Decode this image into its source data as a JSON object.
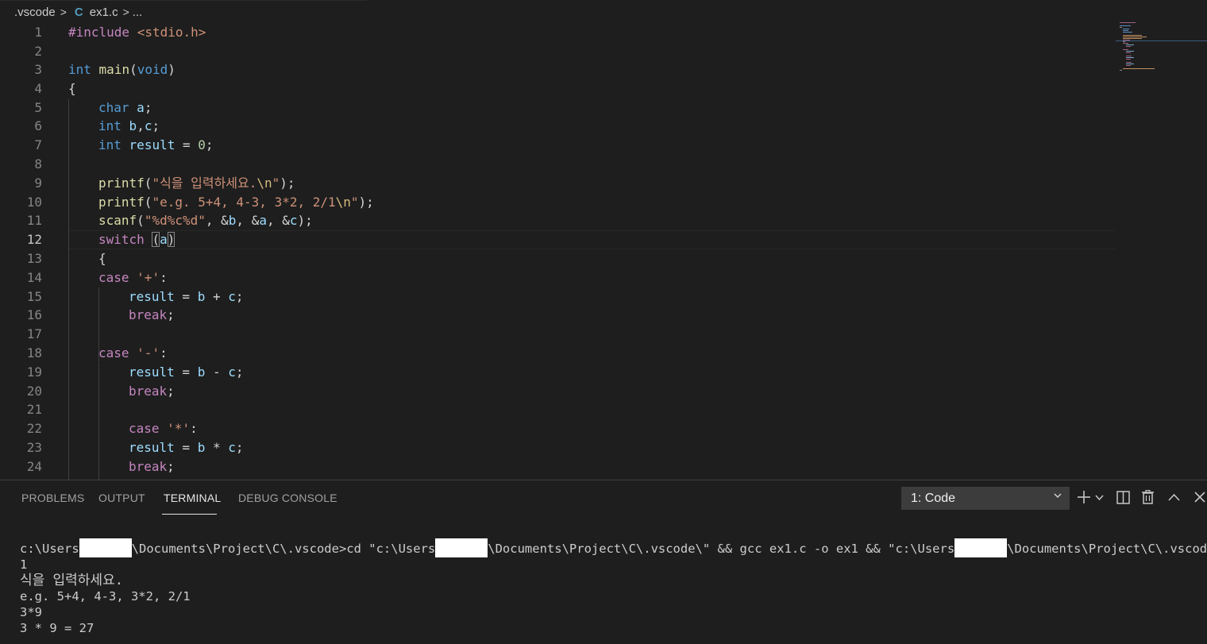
{
  "breadcrumb": {
    "folder": ".vscode",
    "file": "ex1.c",
    "more": "...",
    "file_icon": "C"
  },
  "editor": {
    "active_line": 12,
    "lines": [
      {
        "n": "1"
      },
      {
        "n": "2"
      },
      {
        "n": "3"
      },
      {
        "n": "4"
      },
      {
        "n": "5"
      },
      {
        "n": "6"
      },
      {
        "n": "7"
      },
      {
        "n": "8"
      },
      {
        "n": "9"
      },
      {
        "n": "10"
      },
      {
        "n": "11"
      },
      {
        "n": "12"
      },
      {
        "n": "13"
      },
      {
        "n": "14"
      },
      {
        "n": "15"
      },
      {
        "n": "16"
      },
      {
        "n": "17"
      },
      {
        "n": "18"
      },
      {
        "n": "19"
      },
      {
        "n": "20"
      },
      {
        "n": "21"
      },
      {
        "n": "22"
      },
      {
        "n": "23"
      },
      {
        "n": "24"
      }
    ],
    "code": {
      "l1_inc": "#include",
      "l1_hdr": "<stdio.h>",
      "l3_int": "int",
      "l3_main": "main",
      "l3_void": "void",
      "l4": "{",
      "l5_char": "char",
      "l5_a": "a",
      "l6_int": "int",
      "l6_b": "b",
      "l6_c": "c",
      "l7_int": "int",
      "l7_result": "result",
      "l7_zero": "0",
      "l9_printf": "printf",
      "l9_str": "\"식을 입력하세요.",
      "l9_esc": "\\n",
      "l9_q": "\"",
      "l10_printf": "printf",
      "l10_str": "\"e.g. 5+4, 4-3, 3*2, 2/1",
      "l10_esc": "\\n",
      "l10_q": "\"",
      "l11_scanf": "scanf",
      "l11_fmt": "\"%d%c%d\"",
      "l11_b": "b",
      "l11_a": "a",
      "l11_c": "c",
      "l12_switch": "switch",
      "l12_a": "a",
      "l13": "{",
      "l14_case": "case",
      "l14_ch": "'+'",
      "l15_result": "result",
      "l15_b": "b",
      "l15_c": "c",
      "l16_break": "break",
      "l18_case": "case",
      "l18_ch": "'-'",
      "l19_result": "result",
      "l19_b": "b",
      "l19_c": "c",
      "l20_break": "break",
      "l22_case": "case",
      "l22_ch": "'*'",
      "l23_result": "result",
      "l23_b": "b",
      "l23_c": "c",
      "l24_break": "break"
    }
  },
  "panel": {
    "tabs": [
      "PROBLEMS",
      "OUTPUT",
      "TERMINAL",
      "DEBUG CONSOLE"
    ],
    "active_tab": "TERMINAL",
    "terminal_select": "1: Code",
    "icons": [
      "plus-icon",
      "chevron-down-icon",
      "split-terminal-icon",
      "trash-icon",
      "chevron-up-icon",
      "close-icon"
    ]
  },
  "terminal": {
    "cmd_p1": "c:\\Users",
    "cmd_p2": "\\Documents\\Project\\C\\.vscode>cd \"c:\\Users",
    "cmd_p3": "\\Documents\\Project\\C\\.vscode\\\" && gcc ex1.c -o ex1 && \"c:\\Users",
    "cmd_p4": "\\Documents\\Project\\C\\.vscode\\\"ex",
    "line2": "1",
    "line3": "식을 입력하세요.",
    "line4": "e.g. 5+4, 4-3, 3*2, 2/1",
    "line5": "3*9",
    "line6": "3 * 9 = 27"
  },
  "colors": {
    "background": "#1e1e1e",
    "keyword_control": "#c586c0",
    "keyword_type": "#569cd6",
    "function": "#dcdcaa",
    "variable": "#9cdcfe",
    "string": "#ce9178",
    "number": "#b5cea8"
  }
}
